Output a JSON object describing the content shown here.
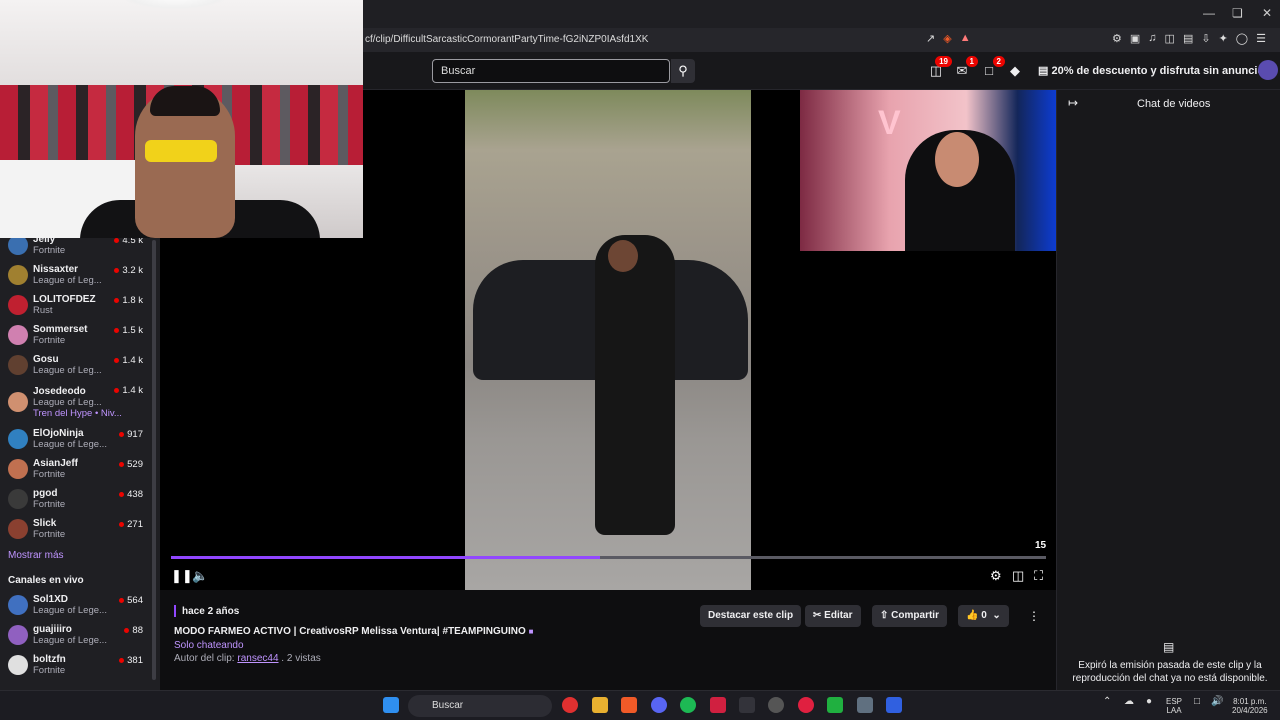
{
  "browser": {
    "url": "cf/clip/DifficultSarcasticCormorantPartyTime-fG2iNZP0IAsfd1XK"
  },
  "header": {
    "search_placeholder": "Buscar",
    "notifications": [
      "19",
      "1",
      "2"
    ],
    "promo": "20% de descuento y disfruta sin anuncios"
  },
  "sidebar": {
    "channels": [
      {
        "name": "Jelly",
        "game": "Fortnite",
        "viewers": "4.5 k",
        "color": "#3a6fb0"
      },
      {
        "name": "Nissaxter",
        "game": "League of Leg...",
        "viewers": "3.2 k",
        "color": "#a08030"
      },
      {
        "name": "LOLITOFDEZ",
        "game": "Rust",
        "viewers": "1.8 k",
        "color": "#c02030"
      },
      {
        "name": "Sommerset",
        "game": "Fortnite",
        "viewers": "1.5 k",
        "color": "#d080b0"
      },
      {
        "name": "Gosu",
        "game": "League of Leg...",
        "viewers": "1.4 k",
        "color": "#604030"
      },
      {
        "name": "Josedeodo",
        "game": "League of Leg...",
        "viewers": "1.4 k",
        "color": "#d09070",
        "extra": "Tren del Hype • Niv..."
      },
      {
        "name": "ElOjoNinja",
        "game": "League of Lege...",
        "viewers": "917",
        "color": "#3080c0"
      },
      {
        "name": "AsianJeff",
        "game": "Fortnite",
        "viewers": "529",
        "color": "#c07050"
      },
      {
        "name": "pgod",
        "game": "Fortnite",
        "viewers": "438",
        "color": "#3a3a3a"
      },
      {
        "name": "Slick",
        "game": "Fortnite",
        "viewers": "271",
        "color": "#8a4030"
      }
    ],
    "show_more": "Mostrar más",
    "live_section": "Canales en vivo",
    "live_channels": [
      {
        "name": "Sol1XD",
        "game": "League of Lege...",
        "viewers": "564",
        "color": "#4070c0"
      },
      {
        "name": "guajiiiro",
        "game": "League of Lege...",
        "viewers": "88",
        "color": "#9060c0"
      },
      {
        "name": "boltzfn",
        "game": "Fortnite",
        "viewers": "381",
        "color": "#e0e0e0"
      }
    ]
  },
  "player": {
    "time_remaining": "15",
    "progress": 0.49,
    "cam_sign": "V"
  },
  "clip_info": {
    "ago": "hace 2 años",
    "title": "MODO FARMEO ACTIVO | CreativosRP Melissa Ventura| #TEAMPINGUINO",
    "category": "Solo chateando",
    "author_label": "Autor del clip:",
    "author": "ransec44",
    "views": ". 2 vistas",
    "actions": {
      "feature": "Destacar este clip",
      "edit": "Editar",
      "share": "Compartir",
      "likes": "0"
    }
  },
  "chat": {
    "title": "Chat de videos",
    "message": "Expiró la emisión pasada de este clip y la reproducción del chat ya no está disponible."
  },
  "taskbar": {
    "search": "Buscar",
    "lang": "ESP",
    "lang2": "LAA",
    "time": "8:01 p.m.",
    "date": "20/4/2026"
  }
}
